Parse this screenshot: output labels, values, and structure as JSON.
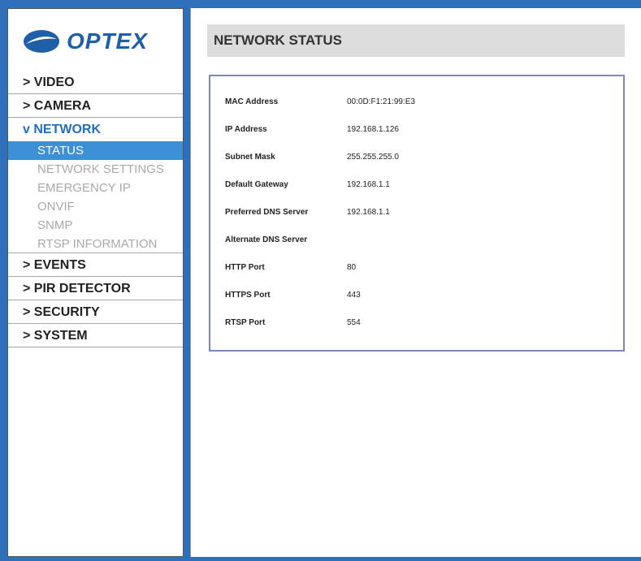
{
  "brand": {
    "logo_text": "OPTEX"
  },
  "nav": {
    "video": "> VIDEO",
    "camera": "> CAMERA",
    "network": "v NETWORK",
    "network_sub": [
      "STATUS",
      "NETWORK SETTINGS",
      "EMERGENCY IP",
      "ONVIF",
      "SNMP",
      "RTSP INFORMATION"
    ],
    "events": "> EVENTS",
    "pir": "> PIR DETECTOR",
    "security": "> SECURITY",
    "system": "> SYSTEM"
  },
  "page": {
    "title": "NETWORK STATUS"
  },
  "status_rows": [
    {
      "label": "MAC Address",
      "value": "00:0D:F1:21:99:E3"
    },
    {
      "label": "IP Address",
      "value": "192.168.1.126"
    },
    {
      "label": "Subnet Mask",
      "value": "255.255.255.0"
    },
    {
      "label": "Default Gateway",
      "value": "192.168.1.1"
    },
    {
      "label": "Preferred DNS Server",
      "value": "192.168.1.1"
    },
    {
      "label": "Alternate DNS Server",
      "value": ""
    },
    {
      "label": "HTTP Port",
      "value": "80"
    },
    {
      "label": "HTTPS Port",
      "value": "443"
    },
    {
      "label": "RTSP Port",
      "value": "554"
    }
  ],
  "colors": {
    "accent": "#3d8fd6",
    "brand": "#1f5fa8",
    "panel_border": "#7f86c2"
  }
}
